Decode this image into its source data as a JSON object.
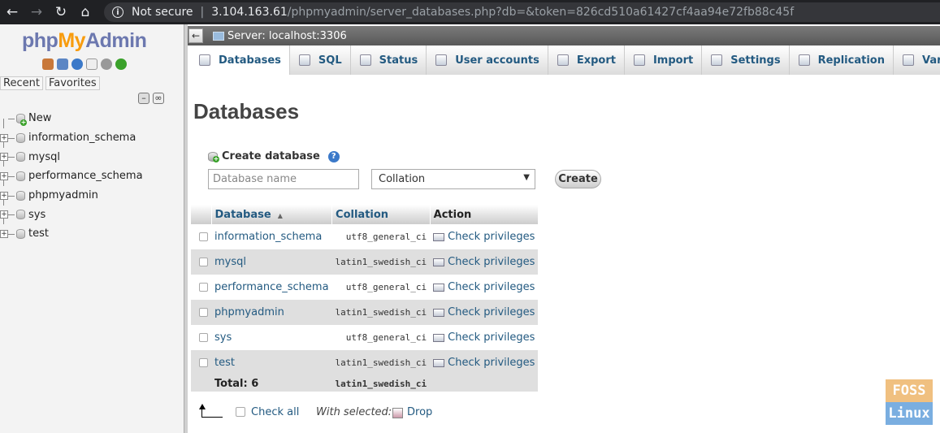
{
  "browser": {
    "back_icon": "←",
    "forward_icon": "→",
    "reload_icon": "↻",
    "home_icon": "⌂",
    "security_label": "Not secure",
    "url_host": "3.104.163.61",
    "url_path": "/phpmyadmin/server_databases.php?db=&token=826cd510a61427cf4aa94e72fb88c45f"
  },
  "logo": {
    "php": "php",
    "my": "My",
    "admin": "Admin"
  },
  "nav": {
    "tabs": [
      "Recent",
      "Favorites"
    ],
    "tree": [
      {
        "label": "New",
        "icon": "new-database-icon"
      },
      {
        "label": "information_schema",
        "icon": "database-icon"
      },
      {
        "label": "mysql",
        "icon": "database-icon"
      },
      {
        "label": "performance_schema",
        "icon": "database-icon"
      },
      {
        "label": "phpmyadmin",
        "icon": "database-icon"
      },
      {
        "label": "sys",
        "icon": "database-icon"
      },
      {
        "label": "test",
        "icon": "database-icon"
      }
    ]
  },
  "server_bar": {
    "collapse_icon": "←",
    "label": "Server: localhost:3306"
  },
  "menu": {
    "tabs": [
      {
        "label": "Databases",
        "icon": "databases-icon",
        "active": true
      },
      {
        "label": "SQL",
        "icon": "sql-icon"
      },
      {
        "label": "Status",
        "icon": "status-icon"
      },
      {
        "label": "User accounts",
        "icon": "user-accounts-icon"
      },
      {
        "label": "Export",
        "icon": "export-icon"
      },
      {
        "label": "Import",
        "icon": "import-icon"
      },
      {
        "label": "Settings",
        "icon": "settings-icon"
      },
      {
        "label": "Replication",
        "icon": "replication-icon"
      },
      {
        "label": "Variables",
        "icon": "variables-icon"
      }
    ]
  },
  "main": {
    "title": "Databases",
    "create_db": {
      "heading": "Create database",
      "help_icon": "?",
      "name_placeholder": "Database name",
      "collation_value": "Collation",
      "create_label": "Create"
    },
    "table": {
      "headers": {
        "database": "Database",
        "collation": "Collation",
        "action": "Action"
      },
      "rows": [
        {
          "name": "information_schema",
          "collation": "utf8_general_ci",
          "action": "Check privileges"
        },
        {
          "name": "mysql",
          "collation": "latin1_swedish_ci",
          "action": "Check privileges"
        },
        {
          "name": "performance_schema",
          "collation": "utf8_general_ci",
          "action": "Check privileges"
        },
        {
          "name": "phpmyadmin",
          "collation": "latin1_swedish_ci",
          "action": "Check privileges"
        },
        {
          "name": "sys",
          "collation": "utf8_general_ci",
          "action": "Check privileges"
        },
        {
          "name": "test",
          "collation": "latin1_swedish_ci",
          "action": "Check privileges"
        }
      ],
      "total_label": "Total: 6",
      "total_collation": "latin1_swedish_ci"
    },
    "footer": {
      "check_all": "Check all",
      "with_selected": "With selected:",
      "drop": "Drop"
    }
  },
  "watermark": {
    "top": "FOSS",
    "bottom": "Linux"
  }
}
